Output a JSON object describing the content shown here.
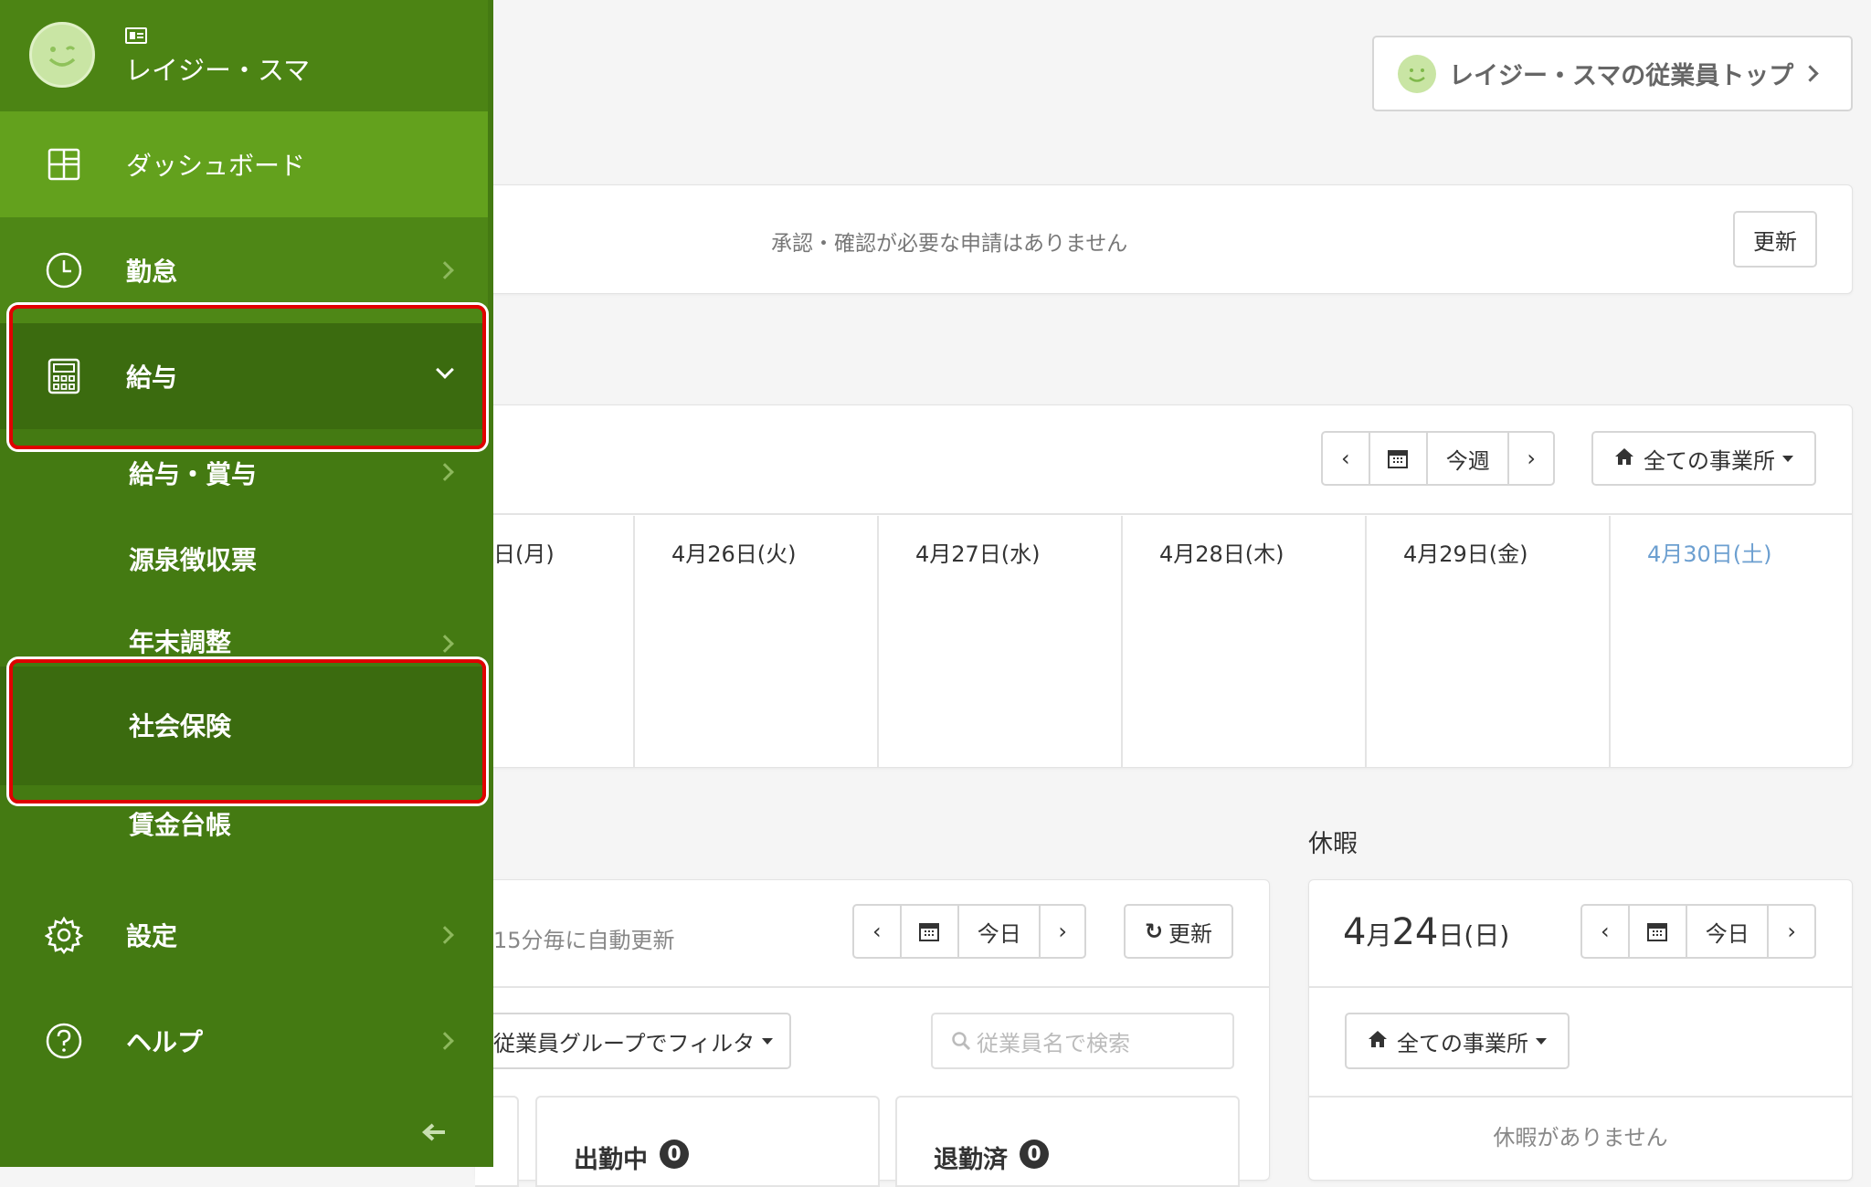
{
  "user": {
    "name": "レイジー・スマ"
  },
  "top_button": {
    "label": "レイジー・スマの従業員トップ"
  },
  "sidebar": {
    "items": [
      {
        "label": "ダッシュボード",
        "icon": "dashboard-icon"
      },
      {
        "label": "勤怠",
        "icon": "clock-icon"
      },
      {
        "label": "給与",
        "icon": "calculator-icon"
      },
      {
        "label": "設定",
        "icon": "gear-icon"
      },
      {
        "label": "ヘルプ",
        "icon": "help-icon"
      }
    ],
    "submenu": [
      {
        "label": "給与・賞与"
      },
      {
        "label": "源泉徴収票"
      },
      {
        "label": "年末調整"
      },
      {
        "label": "社会保険"
      },
      {
        "label": "賃金台帳"
      }
    ]
  },
  "approvals": {
    "message": "承認・確認が必要な申請はありません",
    "refresh_label": "更新"
  },
  "week": {
    "today_label": "今週",
    "office_label": "全ての事業所",
    "days": [
      "日(月)",
      "4月26日(火)",
      "4月27日(水)",
      "4月28日(木)",
      "4月29日(金)",
      "4月30日(土)"
    ]
  },
  "attendance": {
    "auto_update": "15分毎に自動更新",
    "today_label": "今日",
    "refresh_label": "更新",
    "group_filter": "従業員グループでフィルタ",
    "search_placeholder": "従業員名で検索",
    "working_label": "出勤中",
    "working_count": "0",
    "left_label": "退勤済",
    "left_count": "0"
  },
  "vacation": {
    "title": "休暇",
    "date_month": "4",
    "date_month_unit": "月",
    "date_day": "24",
    "date_day_unit": "日",
    "date_weekday": "(日)",
    "today_label": "今日",
    "office_label": "全ての事業所",
    "empty_message": "休暇がありません"
  },
  "colors": {
    "sidebar_bg": "#447a12",
    "sidebar_active": "#63a11d",
    "saturday": "#6c9fd0",
    "highlight": "#e00000"
  }
}
